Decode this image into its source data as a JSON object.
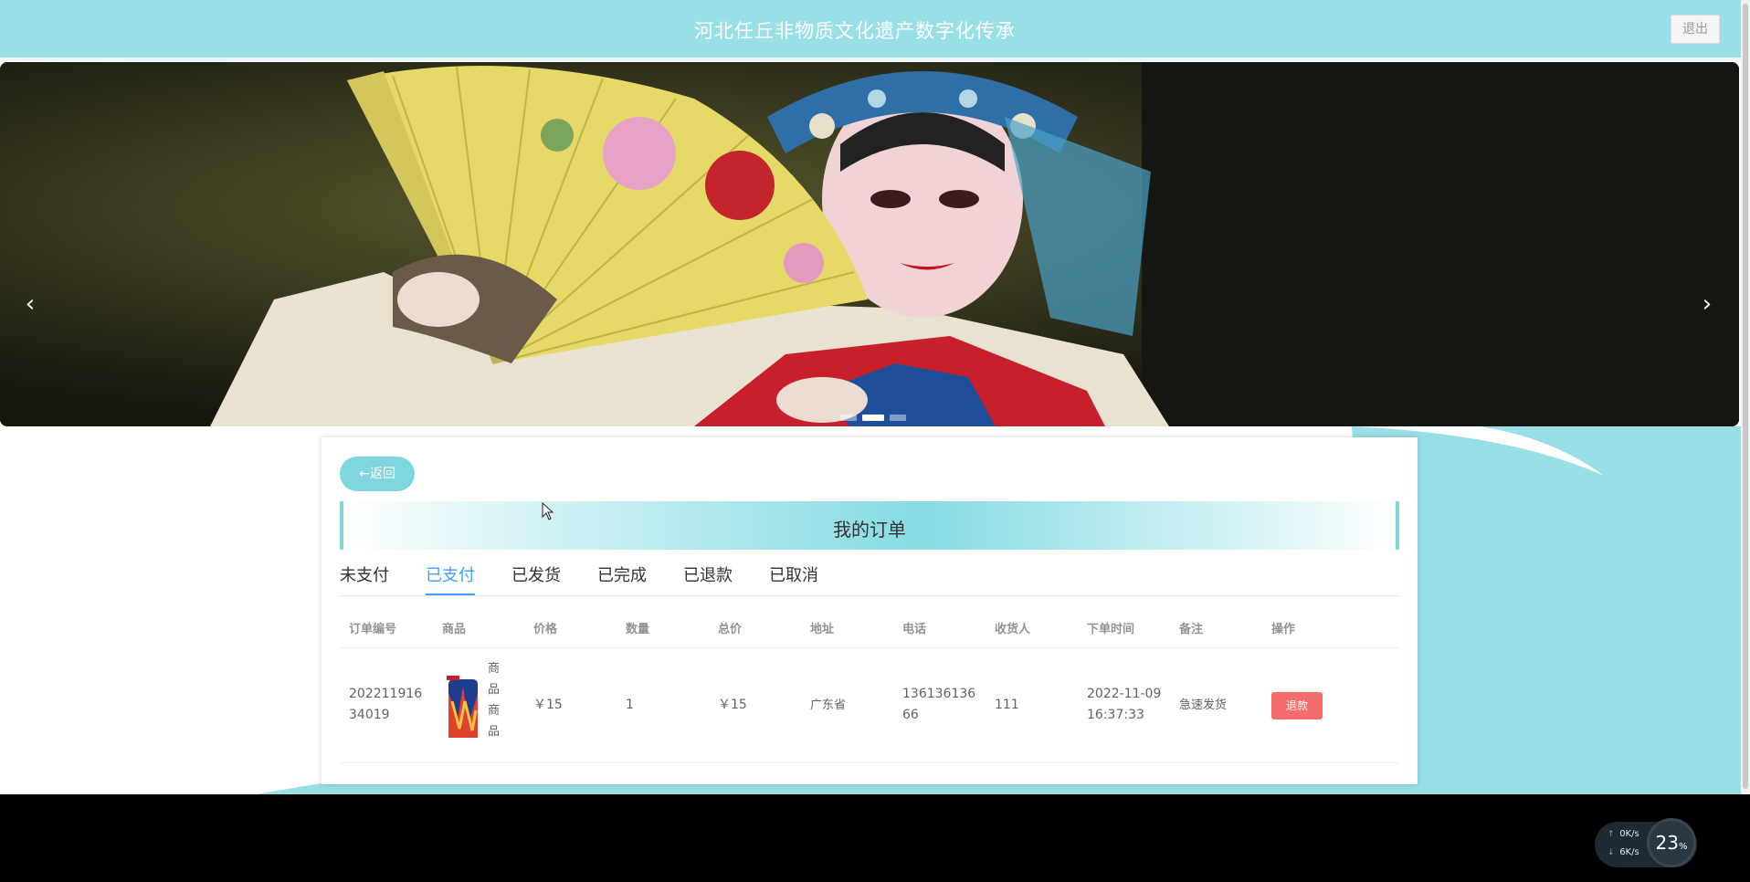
{
  "header": {
    "title": "河北任丘非物质文化遗产数字化传承",
    "logout_label": "退出"
  },
  "carousel": {
    "prev_glyph": "‹",
    "next_glyph": "›",
    "slide_count": 3,
    "active_slide": 2
  },
  "panel": {
    "back_label": "←返回",
    "title": "我的订单",
    "tabs": [
      {
        "label": "未支付",
        "active": false
      },
      {
        "label": "已支付",
        "active": true
      },
      {
        "label": "已发货",
        "active": false
      },
      {
        "label": "已完成",
        "active": false
      },
      {
        "label": "已退款",
        "active": false
      },
      {
        "label": "已取消",
        "active": false
      }
    ],
    "columns": [
      "订单编号",
      "商品",
      "价格",
      "数量",
      "总价",
      "地址",
      "电话",
      "收货人",
      "下单时间",
      "备注",
      "操作"
    ],
    "rows": [
      {
        "order_no_line1": "202211916",
        "order_no_line2": "34019",
        "product_name_chars": [
          "商",
          "品",
          "商",
          "品"
        ],
        "price": "￥15",
        "quantity": "1",
        "total": "￥15",
        "address": "广东省",
        "phone_line1": "136136136",
        "phone_line2": "66",
        "receiver": "111",
        "time_line1": "2022-11-09",
        "time_line2": "16:37:33",
        "note": "急速发货",
        "action_label": "退款"
      }
    ]
  },
  "network_widget": {
    "upload": "0K/s",
    "download": "6K/s",
    "percent": "23",
    "percent_unit": "%"
  },
  "colors": {
    "header_bg": "#99dfe6",
    "accent": "#7fd6de",
    "tab_active": "#409eff",
    "danger": "#f56c6c"
  }
}
